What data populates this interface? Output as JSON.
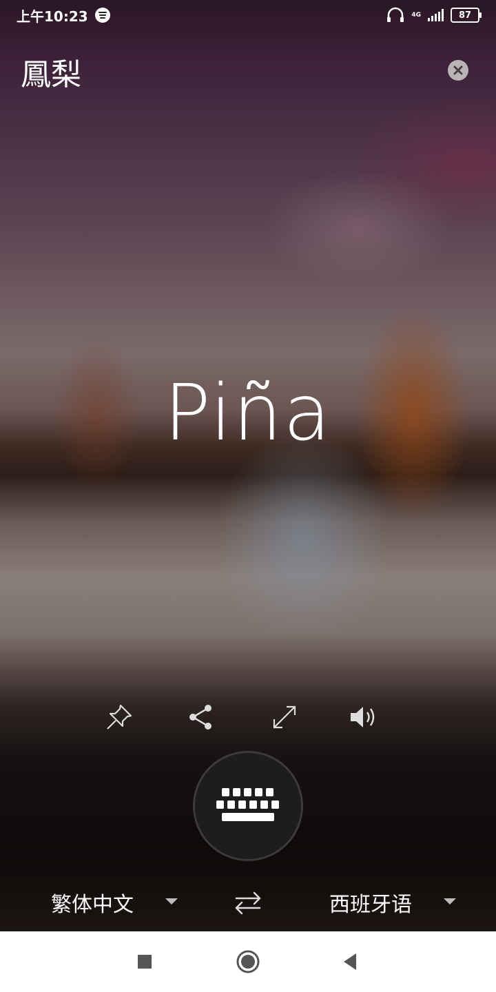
{
  "status_bar": {
    "time": "上午10:23",
    "network": "4G",
    "battery": "87"
  },
  "source": {
    "text": "鳳梨"
  },
  "translation": {
    "text": "Piña"
  },
  "actions": {
    "icons": [
      "pin-icon",
      "share-icon",
      "expand-icon",
      "speaker-icon"
    ]
  },
  "keyboard": {
    "icon": "keyboard-icon"
  },
  "languages": {
    "from": "繁体中文",
    "to": "西班牙语"
  },
  "nav": {
    "icons": [
      "recents-icon",
      "home-icon",
      "back-icon"
    ]
  }
}
